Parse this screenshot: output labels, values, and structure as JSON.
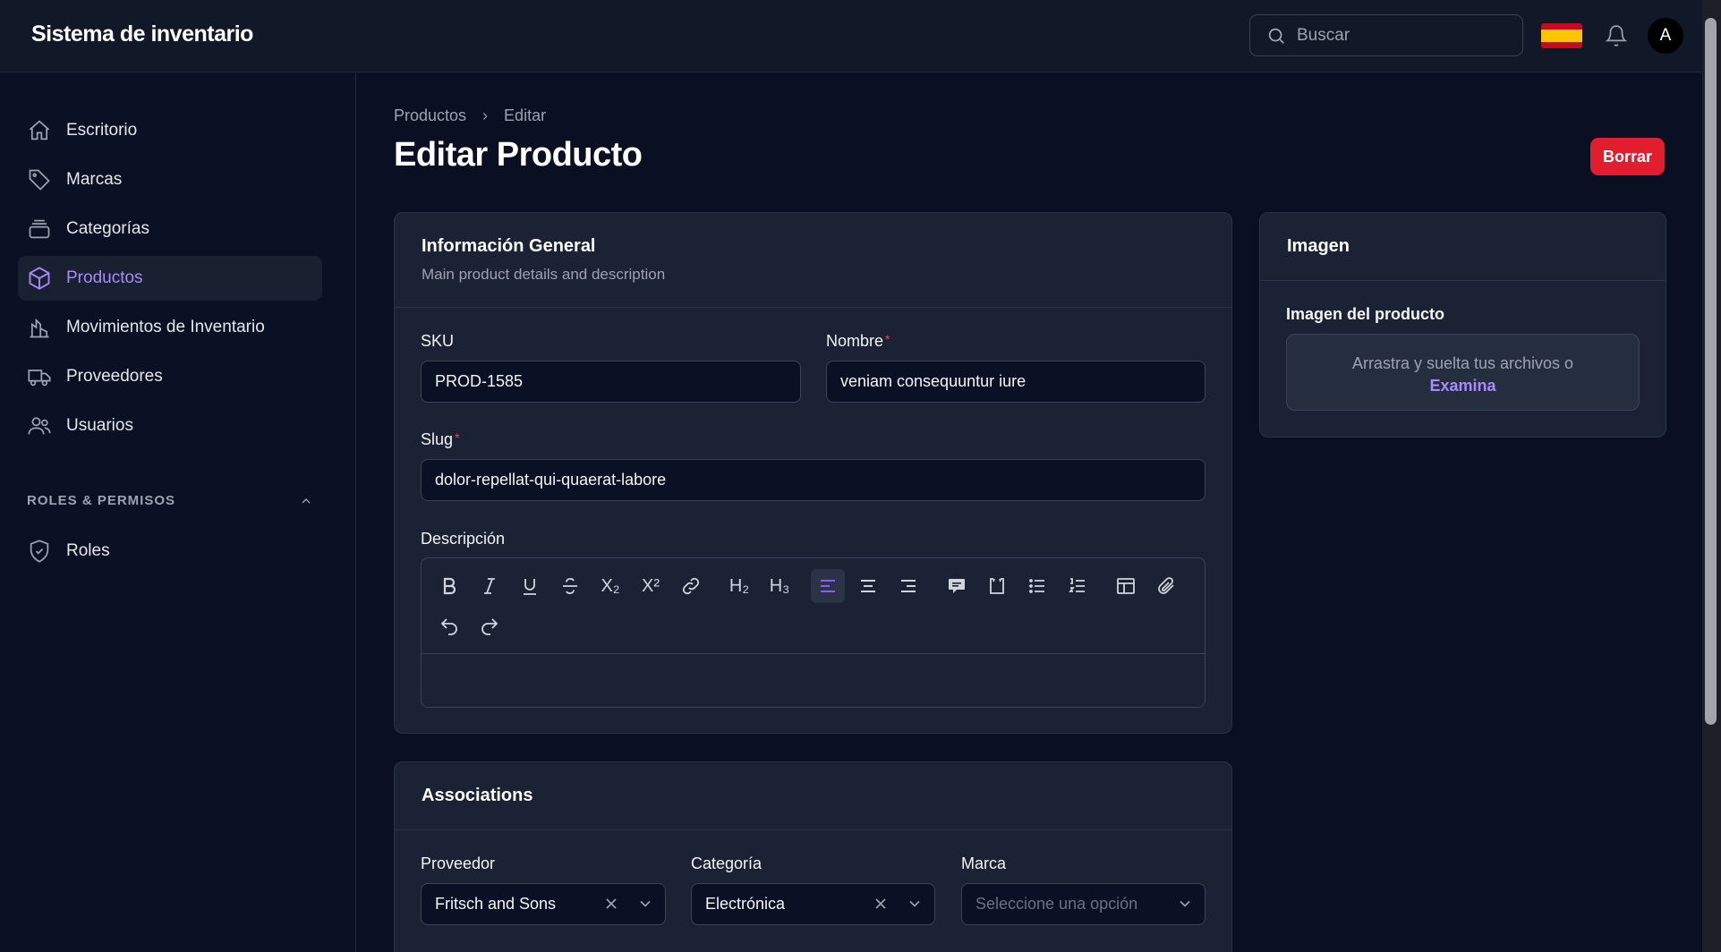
{
  "app": {
    "title": "Sistema de inventario"
  },
  "topbar": {
    "search_placeholder": "Buscar",
    "avatar_initial": "A"
  },
  "sidebar": {
    "items": [
      {
        "label": "Escritorio",
        "icon": "home-icon"
      },
      {
        "label": "Marcas",
        "icon": "tag-icon"
      },
      {
        "label": "Categorías",
        "icon": "stack-icon"
      },
      {
        "label": "Productos",
        "icon": "cube-icon",
        "active": true
      },
      {
        "label": "Movimientos de Inventario",
        "icon": "chart-icon"
      },
      {
        "label": "Proveedores",
        "icon": "truck-icon"
      },
      {
        "label": "Usuarios",
        "icon": "users-icon"
      }
    ],
    "section_label": "ROLES & PERMISOS",
    "section_items": [
      {
        "label": "Roles",
        "icon": "shield-icon"
      }
    ]
  },
  "breadcrumb": {
    "parent": "Productos",
    "current": "Editar"
  },
  "page": {
    "title": "Editar Producto",
    "delete_label": "Borrar"
  },
  "general": {
    "title": "Información General",
    "subtitle": "Main product details and description",
    "sku_label": "SKU",
    "sku_value": "PROD-1585",
    "name_label": "Nombre",
    "name_value": "veniam consequuntur iure",
    "slug_label": "Slug",
    "slug_value": "dolor-repellat-qui-quaerat-labore",
    "description_label": "Descripción",
    "toolbar": {
      "h2": "H₂",
      "h3": "H₃",
      "subscript": "X₂",
      "superscript": "X²"
    }
  },
  "image": {
    "title": "Imagen",
    "field_label": "Imagen del producto",
    "drop_text": "Arrastra y suelta tus archivos o",
    "browse": "Examina"
  },
  "associations": {
    "title": "Associations",
    "supplier_label": "Proveedor",
    "supplier_value": "Fritsch and Sons",
    "category_label": "Categoría",
    "category_value": "Electrónica",
    "brand_label": "Marca",
    "brand_placeholder": "Seleccione una opción"
  },
  "colors": {
    "accent": "#a78bfa",
    "danger": "#e11d2e",
    "background": "#0a1021",
    "card": "#1a2233"
  }
}
